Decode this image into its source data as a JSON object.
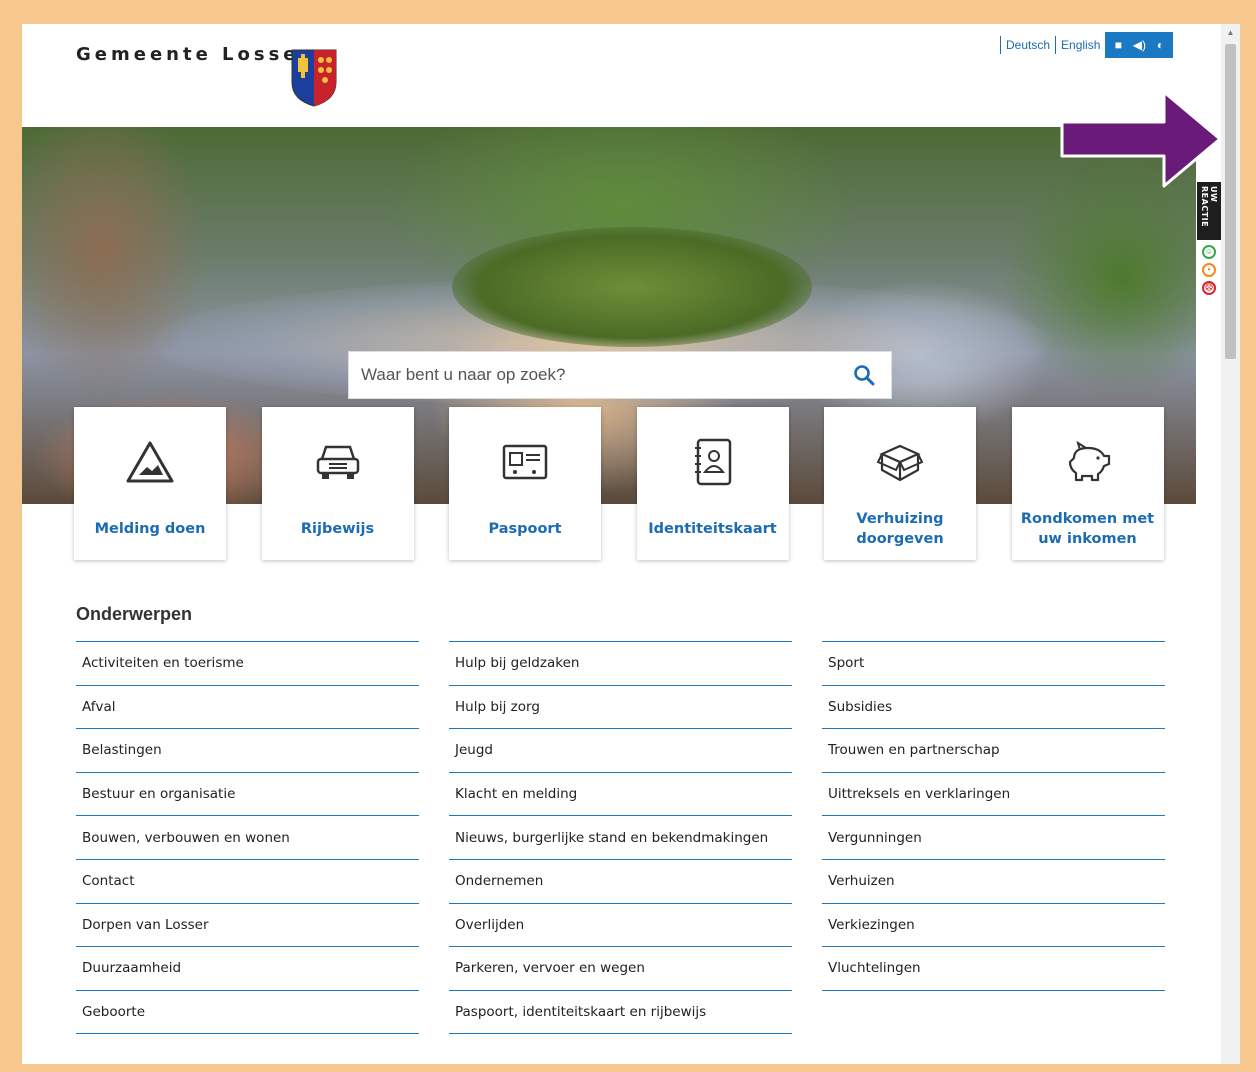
{
  "header": {
    "site_name": "Gemeente Losser",
    "languages": [
      "Deutsch",
      "English"
    ],
    "tools": {
      "contrast_icon": "contrast-icon",
      "speak_icon": "speaker-icon",
      "stop_icon": "stop-icon"
    }
  },
  "search": {
    "placeholder": "Waar bent u naar op zoek?",
    "button_icon": "search-icon"
  },
  "tiles": [
    {
      "label": "Melding doen",
      "icon": "warning-triangle-icon"
    },
    {
      "label": "Rijbewijs",
      "icon": "car-icon"
    },
    {
      "label": "Paspoort",
      "icon": "id-card-icon"
    },
    {
      "label": "Identiteitskaart",
      "icon": "address-book-icon"
    },
    {
      "label": "Verhuizing doorgeven",
      "icon": "moving-box-icon"
    },
    {
      "label": "Rondkomen met uw inkomen",
      "icon": "piggy-bank-icon"
    }
  ],
  "topics": {
    "title": "Onderwerpen",
    "columns": [
      [
        "Activiteiten en toerisme",
        "Afval",
        "Belastingen",
        "Bestuur en organisatie",
        "Bouwen, verbouwen en wonen",
        "Contact",
        "Dorpen van Losser",
        "Duurzaamheid",
        "Geboorte"
      ],
      [
        "Hulp bij geldzaken",
        "Hulp bij zorg",
        "Jeugd",
        "Klacht en melding",
        "Nieuws, burgerlijke stand en bekendmakingen",
        "Ondernemen",
        "Overlijden",
        "Parkeren, vervoer en wegen",
        "Paspoort, identiteitskaart en rijbewijs"
      ],
      [
        "Sport",
        "Subsidies",
        "Trouwen en partnerschap",
        "Uittreksels en verklaringen",
        "Vergunningen",
        "Verhuizen",
        "Verkiezingen",
        "Vluchtelingen"
      ]
    ]
  },
  "feedback": {
    "label": "UW REACTIE"
  },
  "colors": {
    "accent": "#1b6cb3",
    "frame": "#f6c88e",
    "annotation_arrow": "#6a1b7a"
  }
}
